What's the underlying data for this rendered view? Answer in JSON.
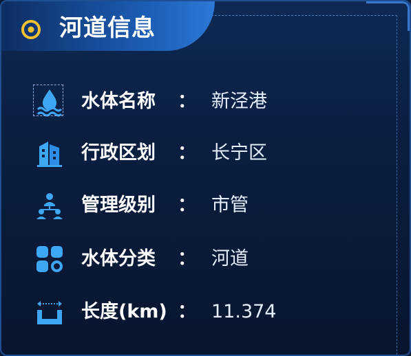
{
  "header": {
    "title": "河道信息",
    "icon": "target-ring-icon",
    "accent": "#f2c230"
  },
  "rows": [
    {
      "label": "水体名称",
      "colon": "：",
      "value": "新泾港",
      "icon": "water-drop-icon"
    },
    {
      "label": "行政区划",
      "colon": "：",
      "value": "长宁区",
      "icon": "building-icon"
    },
    {
      "label": "管理级别",
      "colon": "：",
      "value": "市管",
      "icon": "hierarchy-icon"
    },
    {
      "label": "水体分类",
      "colon": "：",
      "value": "河道",
      "icon": "category-grid-icon"
    },
    {
      "label": "长度(km)",
      "colon": "：",
      "value": "11.374",
      "icon": "length-ruler-icon"
    }
  ],
  "colors": {
    "background": "#0b1a35",
    "header_gradient_end": "#2d78d6",
    "icon_blue": "#3da6f5",
    "text": "#ffffff"
  }
}
